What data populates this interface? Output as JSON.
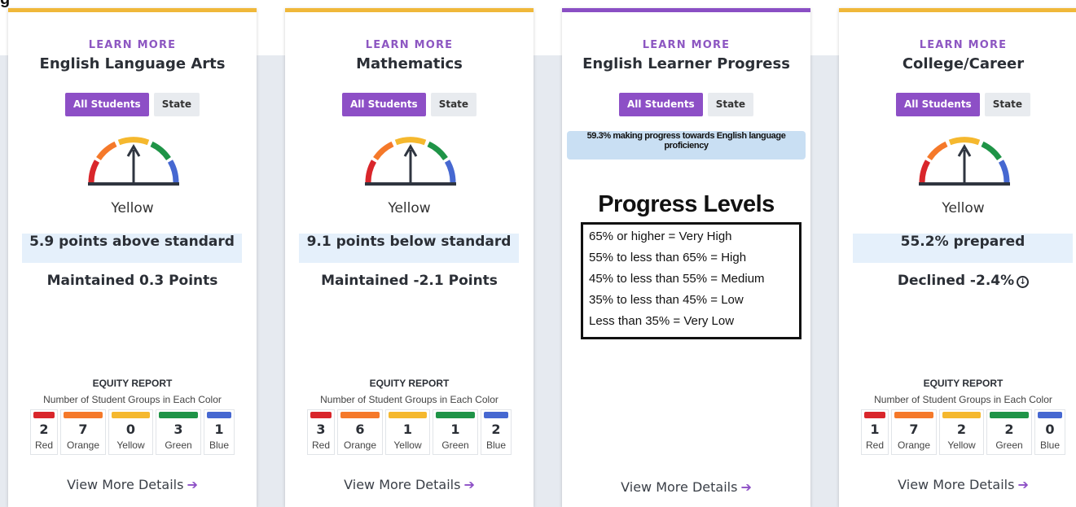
{
  "colors": {
    "accent": "#8d4fc6",
    "card_top_yellow": "#f0b83a",
    "card_top_purple": "#8a4fc4",
    "status_bg": "#e5f0fb",
    "red": "#d9262b",
    "orange": "#f5792a",
    "yellow": "#f5b82e",
    "green": "#1f9447",
    "blue": "#4668d1"
  },
  "labels": {
    "learn_more": "LEARN MORE",
    "all_students": "All Students",
    "state": "State",
    "equity_title": "EQUITY REPORT",
    "equity_subtitle": "Number of Student Groups in Each Color",
    "view_more": "View More Details",
    "red": "Red",
    "orange": "Orange",
    "yellow": "Yellow",
    "green": "Green",
    "blue": "Blue"
  },
  "cards": [
    {
      "title": "English Language Arts",
      "gauge_color": "Yellow",
      "status": "5.9 points above standard",
      "change": "Maintained 0.3 Points",
      "equity": {
        "red": "2",
        "orange": "7",
        "yellow": "0",
        "green": "3",
        "blue": "1"
      }
    },
    {
      "title": "Mathematics",
      "gauge_color": "Yellow",
      "status": "9.1 points below standard",
      "change": "Maintained -2.1 Points",
      "equity": {
        "red": "3",
        "orange": "6",
        "yellow": "1",
        "green": "1",
        "blue": "2"
      }
    },
    {
      "title": "English Learner Progress",
      "banner": "59.3% making progress towards English language proficiency",
      "levels_title": "Progress Levels",
      "levels": [
        "65% or higher = Very High",
        "55% to less than 65% = High",
        "45% to less than 55% = Medium",
        "35% to less than 45% = Low",
        "Less than 35% = Very Low"
      ]
    },
    {
      "title": "College/Career",
      "gauge_color": "Yellow",
      "status": "55.2% prepared",
      "change": "Declined -2.4%",
      "change_icon": "arrow-down-circle-icon",
      "equity": {
        "red": "1",
        "orange": "7",
        "yellow": "2",
        "green": "2",
        "blue": "0"
      }
    }
  ]
}
